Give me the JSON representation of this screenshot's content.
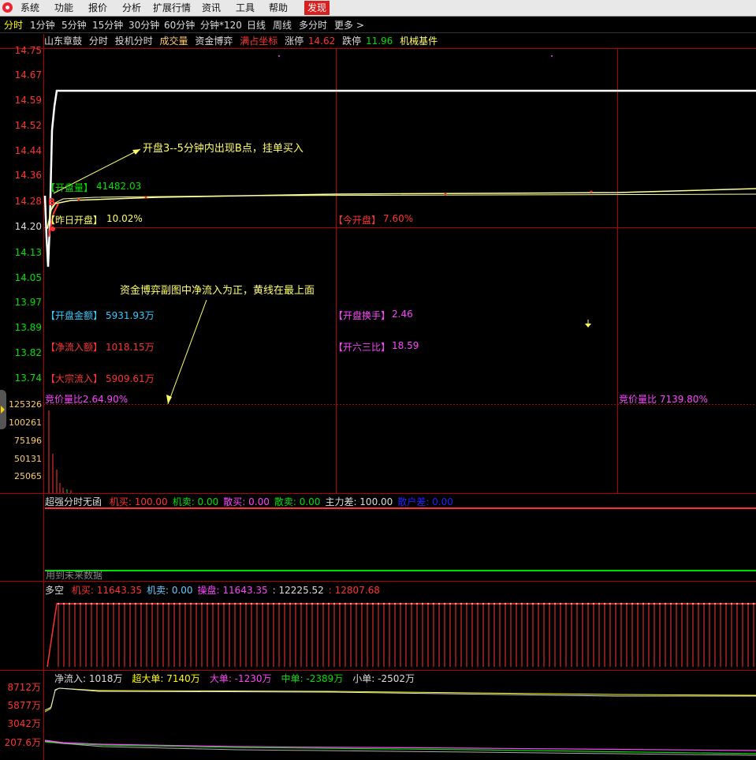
{
  "menu": {
    "items": [
      "系统",
      "功能",
      "报价",
      "分析",
      "扩展行情",
      "资讯",
      "工具",
      "帮助",
      "发现"
    ],
    "highlight": "发现"
  },
  "periods": {
    "items": [
      "分时",
      "1分钟",
      "5分钟",
      "15分钟",
      "30分钟",
      "60分钟",
      "分钟*120",
      "日线",
      "周线",
      "多分时",
      "更多 >"
    ],
    "active": "分时"
  },
  "header": {
    "stock_name": "山东章鼓",
    "view": "分时",
    "indicators": [
      "投机分时",
      "成交量",
      "资金博弈"
    ],
    "full_coord": "满占坐标",
    "limit_up_label": "涨停",
    "limit_up_value": "14.62",
    "limit_down_label": "跌停",
    "limit_down_value": "11.96",
    "sector": "机械基件"
  },
  "price_axis": [
    "14.75",
    "14.67",
    "14.59",
    "14.52",
    "14.44",
    "14.36",
    "14.28",
    "14.20",
    "14.13",
    "14.05",
    "13.97",
    "13.89",
    "13.82",
    "13.74"
  ],
  "volume_axis": [
    "125326",
    "100261",
    "75196",
    "50131",
    "25065"
  ],
  "flow_axis": [
    "8712万",
    "5877万",
    "3042万",
    "207.6万"
  ],
  "labels": {
    "open_volume_label": "【开盘量】",
    "open_volume_value": "41482.03",
    "prev_open_label": "【昨日开盘】",
    "prev_open_value": "10.02%",
    "today_open_label": "【今开盘】",
    "today_open_value": "7.60%",
    "open_amount_label": "【开盘金额】",
    "open_amount_value": "5931.93万",
    "open_turnover_label": "【开盘换手】",
    "open_turnover_value": "2.46",
    "net_inflow_label": "【净流入额】",
    "net_inflow_value": "1018.15万",
    "ratio_label": "【开六三比】",
    "ratio_value": "18.59",
    "block_flow_label": "【大宗流入】",
    "block_flow_value": "5909.61万",
    "vol_left_overlap": "竞价量比2.64.90%",
    "vol_right_overlap": "竞价量比 7139.80%"
  },
  "annotations": {
    "a1": "开盘3--5分钟内出现B点，挂单买入",
    "a2": "资金博弈副图中净流入为正，黄线在最上面"
  },
  "marker_b": "B",
  "panel1": {
    "title": "超强分时无函",
    "items": [
      {
        "label": "机买:",
        "value": "100.00",
        "color": "#ff3232"
      },
      {
        "label": "机卖:",
        "value": "0.00",
        "color": "#00e000"
      },
      {
        "label": "散买:",
        "value": "0.00",
        "color": "#ff44ff"
      },
      {
        "label": "散卖:",
        "value": "0.00",
        "color": "#00e000"
      },
      {
        "label": "主力差:",
        "value": "100.00",
        "color": "#dddddd"
      },
      {
        "label": "散户差:",
        "value": "0.00",
        "color": "#2222ff"
      }
    ],
    "future_note": "用到未来数据"
  },
  "panel2": {
    "title": "多空",
    "items": [
      {
        "label": "机买:",
        "value": "11643.35",
        "color": "#ff3232"
      },
      {
        "label": "机卖:",
        "value": "0.00",
        "color": "#66ccff"
      },
      {
        "label": "操盘:",
        "value": "11643.35",
        "color": "#ff44ff"
      },
      {
        "label": ":",
        "value": "12225.52",
        "color": "#dddddd"
      },
      {
        "label": ":",
        "value": "12807.68",
        "color": "#ff3232"
      }
    ]
  },
  "panel3": {
    "items": [
      {
        "label": "净流入:",
        "value": "1018万",
        "color": "#dddddd"
      },
      {
        "label": "超大单:",
        "value": "7140万",
        "color": "#ffff00"
      },
      {
        "label": "大单:",
        "value": "-1230万",
        "color": "#ff44ff"
      },
      {
        "label": "中单:",
        "value": "-2389万",
        "color": "#00e000"
      },
      {
        "label": "小单:",
        "value": "-2502万",
        "color": "#dddddd"
      }
    ]
  }
}
